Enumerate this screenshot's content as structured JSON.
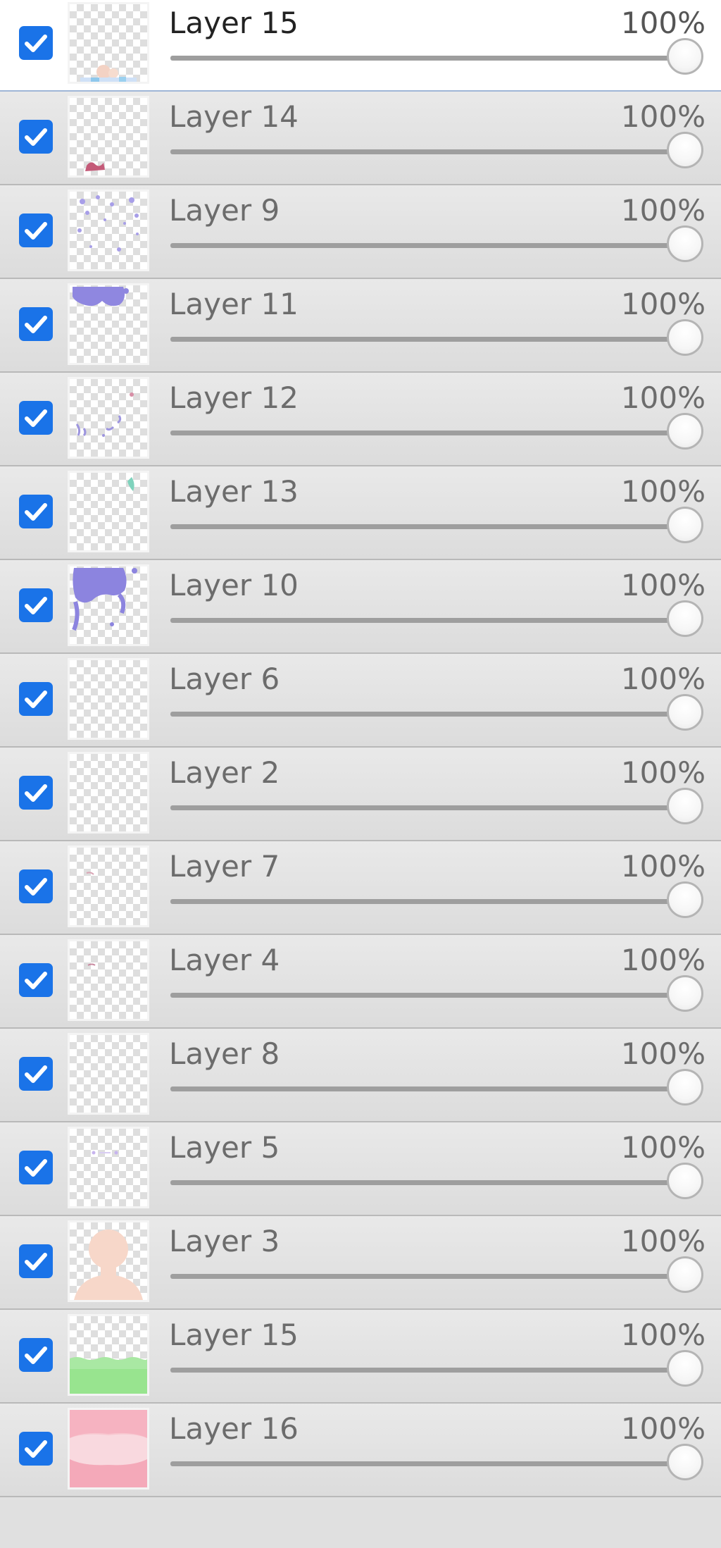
{
  "layers_panel": {
    "layers": [
      {
        "name": "Layer 15",
        "opacity": "100%",
        "opacity_value": 100,
        "visible": true,
        "selected": true,
        "thumb": "thumb-15a"
      },
      {
        "name": "Layer 14",
        "opacity": "100%",
        "opacity_value": 100,
        "visible": true,
        "selected": false,
        "thumb": "thumb-14"
      },
      {
        "name": "Layer 9",
        "opacity": "100%",
        "opacity_value": 100,
        "visible": true,
        "selected": false,
        "thumb": "thumb-9"
      },
      {
        "name": "Layer 11",
        "opacity": "100%",
        "opacity_value": 100,
        "visible": true,
        "selected": false,
        "thumb": "thumb-11"
      },
      {
        "name": "Layer 12",
        "opacity": "100%",
        "opacity_value": 100,
        "visible": true,
        "selected": false,
        "thumb": "thumb-12"
      },
      {
        "name": "Layer 13",
        "opacity": "100%",
        "opacity_value": 100,
        "visible": true,
        "selected": false,
        "thumb": "thumb-13"
      },
      {
        "name": "Layer 10",
        "opacity": "100%",
        "opacity_value": 100,
        "visible": true,
        "selected": false,
        "thumb": "thumb-10"
      },
      {
        "name": "Layer 6",
        "opacity": "100%",
        "opacity_value": 100,
        "visible": true,
        "selected": false,
        "thumb": "thumb-blank"
      },
      {
        "name": "Layer 2",
        "opacity": "100%",
        "opacity_value": 100,
        "visible": true,
        "selected": false,
        "thumb": "thumb-blank"
      },
      {
        "name": "Layer 7",
        "opacity": "100%",
        "opacity_value": 100,
        "visible": true,
        "selected": false,
        "thumb": "thumb-7"
      },
      {
        "name": "Layer 4",
        "opacity": "100%",
        "opacity_value": 100,
        "visible": true,
        "selected": false,
        "thumb": "thumb-4"
      },
      {
        "name": "Layer 8",
        "opacity": "100%",
        "opacity_value": 100,
        "visible": true,
        "selected": false,
        "thumb": "thumb-blank"
      },
      {
        "name": "Layer 5",
        "opacity": "100%",
        "opacity_value": 100,
        "visible": true,
        "selected": false,
        "thumb": "thumb-5"
      },
      {
        "name": "Layer 3",
        "opacity": "100%",
        "opacity_value": 100,
        "visible": true,
        "selected": false,
        "thumb": "thumb-3"
      },
      {
        "name": "Layer 15",
        "opacity": "100%",
        "opacity_value": 100,
        "visible": true,
        "selected": false,
        "thumb": "thumb-15b"
      },
      {
        "name": "Layer 16",
        "opacity": "100%",
        "opacity_value": 100,
        "visible": true,
        "selected": false,
        "thumb": "thumb-16"
      }
    ]
  },
  "colors": {
    "checkbox": "#1a73e8",
    "row_background": "#e1e1e1",
    "selected_row_background": "#ffffff",
    "slider_track": "#9e9e9e"
  },
  "icons": {
    "checkbox": "checkmark-icon",
    "slider": "slider-knob"
  }
}
